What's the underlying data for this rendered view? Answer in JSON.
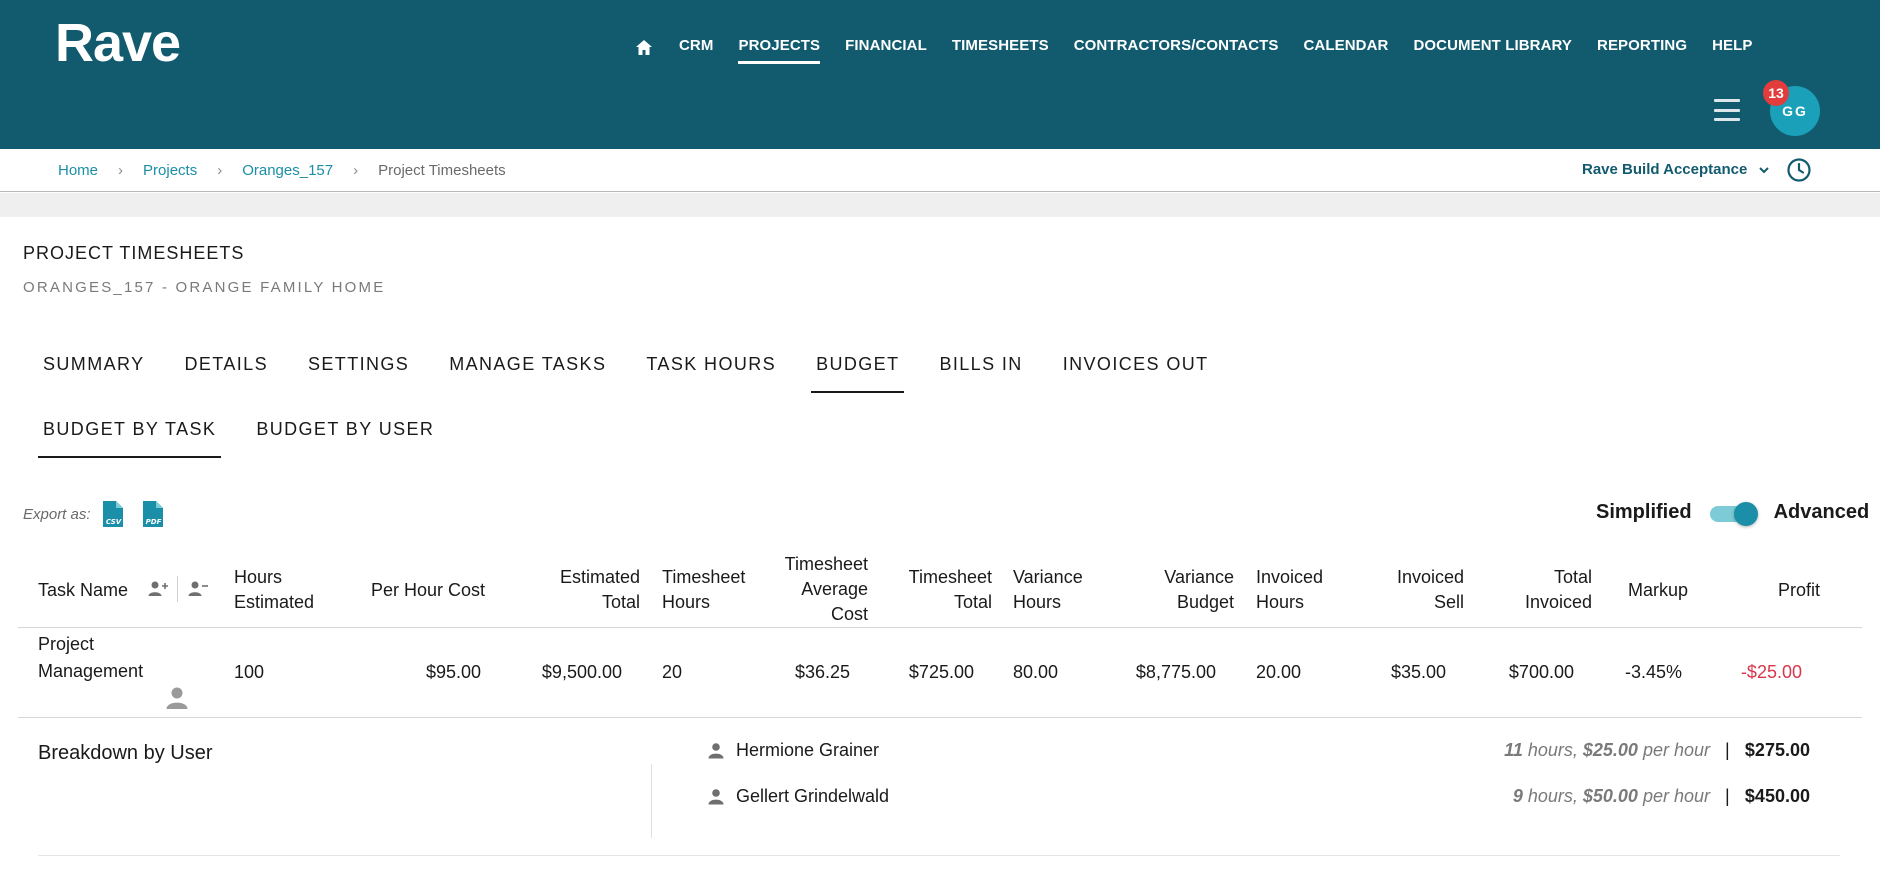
{
  "header": {
    "logo": "Rave",
    "nav": [
      {
        "label": "CRM"
      },
      {
        "label": "PROJECTS",
        "active": true
      },
      {
        "label": "FINANCIAL"
      },
      {
        "label": "TIMESHEETS"
      },
      {
        "label": "CONTRACTORS/CONTACTS"
      },
      {
        "label": "CALENDAR"
      },
      {
        "label": "DOCUMENT LIBRARY"
      },
      {
        "label": "REPORTING"
      },
      {
        "label": "HELP"
      }
    ],
    "notification_count": "13",
    "avatar_initials": "GG",
    "brand_color": "#125b6f",
    "accent_color": "#1a8fa7"
  },
  "breadcrumb": {
    "home": "Home",
    "projects": "Projects",
    "project": "Oranges_157",
    "current": "Project Timesheets"
  },
  "workspace": "Rave Build Acceptance",
  "page": {
    "title": "PROJECT TIMESHEETS",
    "subtitle": "ORANGES_157 - ORANGE FAMILY HOME"
  },
  "tabs": [
    "SUMMARY",
    "DETAILS",
    "SETTINGS",
    "MANAGE TASKS",
    "TASK HOURS",
    "BUDGET",
    "BILLS IN",
    "INVOICES OUT"
  ],
  "active_tab": "BUDGET",
  "subtabs": [
    "BUDGET BY TASK",
    "BUDGET BY USER"
  ],
  "active_subtab": "BUDGET BY TASK",
  "export": {
    "label": "Export as:",
    "csv": "CSV",
    "pdf": "PDF"
  },
  "view_toggle": {
    "left_label": "Simplified",
    "right_label": "Advanced",
    "state": "Advanced"
  },
  "table": {
    "headers": {
      "task_name": "Task Name",
      "hours_estimated_1": "Hours",
      "hours_estimated_2": "Estimated",
      "per_hour_cost": "Per Hour Cost",
      "estimated_total_1": "Estimated",
      "estimated_total_2": "Total",
      "timesheet_hours_1": "Timesheet",
      "timesheet_hours_2": "Hours",
      "timesheet_avg_1": "Timesheet",
      "timesheet_avg_2": "Average",
      "timesheet_avg_3": "Cost",
      "timesheet_total_1": "Timesheet",
      "timesheet_total_2": "Total",
      "variance_hours_1": "Variance",
      "variance_hours_2": "Hours",
      "variance_budget_1": "Variance",
      "variance_budget_2": "Budget",
      "invoiced_hours_1": "Invoiced",
      "invoiced_hours_2": "Hours",
      "invoiced_sell_1": "Invoiced",
      "invoiced_sell_2": "Sell",
      "total_invoiced_1": "Total",
      "total_invoiced_2": "Invoiced",
      "markup": "Markup",
      "profit": "Profit"
    },
    "row": {
      "task_name": "Project Management",
      "hours_estimated": "100",
      "per_hour_cost": "$95.00",
      "estimated_total": "$9,500.00",
      "timesheet_hours": "20",
      "timesheet_avg_cost": "$36.25",
      "timesheet_total": "$725.00",
      "variance_hours": "80.00",
      "variance_budget": "$8,775.00",
      "invoiced_hours": "20.00",
      "invoiced_sell": "$35.00",
      "total_invoiced": "$700.00",
      "markup": "-3.45%",
      "profit": "-$25.00"
    }
  },
  "breakdown": {
    "title": "Breakdown by User",
    "users": [
      {
        "name": "Hermione Grainer",
        "hours": "11",
        "hours_text": " hours, ",
        "rate": "$25.00",
        "rate_text": " per hour",
        "total": "$275.00"
      },
      {
        "name": "Gellert Grindelwald",
        "hours": "9",
        "hours_text": " hours, ",
        "rate": "$50.00",
        "rate_text": " per hour",
        "total": "$450.00"
      }
    ],
    "separator": "|"
  }
}
